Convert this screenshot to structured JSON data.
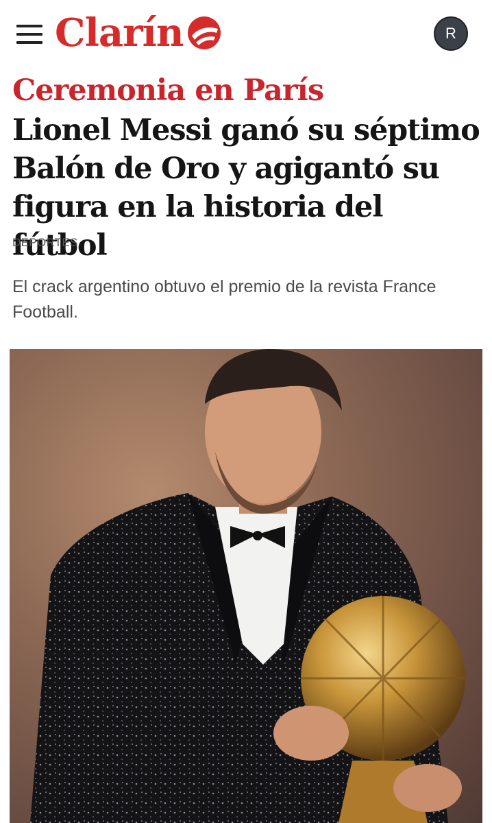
{
  "header": {
    "logo_text": "Clarín",
    "avatar_initial": "R",
    "brand_color": "#d62b2b"
  },
  "article": {
    "kicker": "Ceremonia en París",
    "headline": "Lionel Messi ganó su séptimo Balón de Oro y agigantó su figura en la historia del fútbol",
    "section": "DEPORTES",
    "summary": "El crack argentino obtuvo el premio de la revista France Football."
  }
}
